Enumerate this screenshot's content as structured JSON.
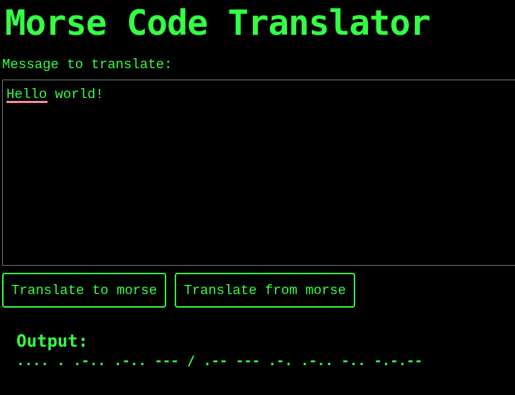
{
  "header": {
    "title": "Morse Code Translator"
  },
  "input": {
    "label": "Message to translate:",
    "value": "Hello world!",
    "misspelled_word": "Hello"
  },
  "buttons": {
    "to_morse": "Translate to morse",
    "from_morse": "Translate from morse"
  },
  "output": {
    "label": "Output:",
    "value": ".... . .-.. .-.. --- / .-- --- .-. .-.. -.. -.-.--"
  },
  "colors": {
    "background": "#000000",
    "accent": "#33ff44",
    "textarea_border": "#777777",
    "spellcheck_underline": "#ff8c9a"
  }
}
